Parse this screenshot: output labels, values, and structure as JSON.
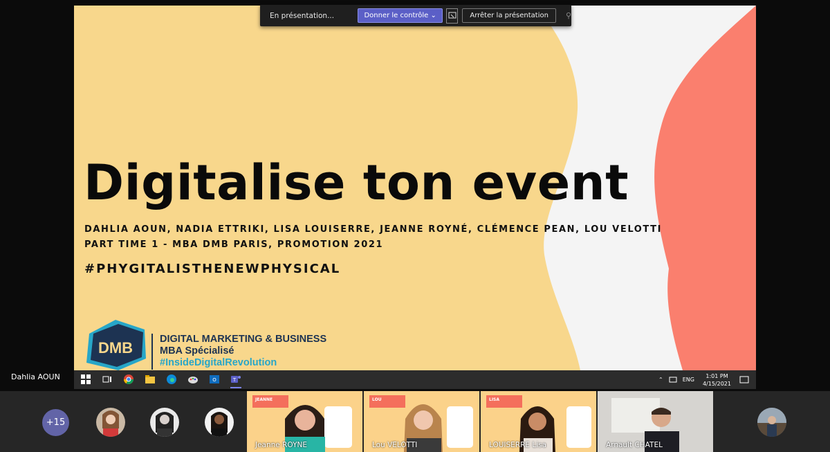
{
  "presentation_bar": {
    "status": "En présentation...",
    "give_control": "Donner le contrôle",
    "stop": "Arrêter la présentation"
  },
  "slide": {
    "title": "Digitalise ton event",
    "authors_line1": "DAHLIA AOUN, NADIA ETTRIKI, LISA LOUISERRE, JEANNE ROYNÉ, CLÉMENCE PEAN, LOU VELOTTI",
    "authors_line2": "PART TIME 1 - MBA DMB PARIS, PROMOTION 2021",
    "hashtag": "#PHYGITALISTHENEWPHYSICAL",
    "logo": {
      "mark": "DMB",
      "line1": "DIGITAL MARKETING & BUSINESS",
      "line2": "MBA Spécialisé",
      "line3": "#InsideDigitalRevolution"
    },
    "colors": {
      "yellow": "#f8d78c",
      "coral": "#fa7f6e",
      "background": "#f4f4f4",
      "logo_navy": "#1d3352",
      "logo_cyan": "#27a6c8"
    }
  },
  "taskbar": {
    "icons": [
      "windows-start-icon",
      "task-view-icon",
      "chrome-icon",
      "file-explorer-icon",
      "edge-icon",
      "paint-icon",
      "outlook-icon",
      "teams-icon"
    ],
    "lang": "ENG",
    "time": "1:01 PM",
    "date": "4/15/2021"
  },
  "presenter": "Dahlia AOUN",
  "participants": {
    "more": "+15",
    "tiles": [
      {
        "name": "Jeanne ROYNE",
        "tag": "JEANNE"
      },
      {
        "name": "Lou VELOTTI",
        "tag": "LOU"
      },
      {
        "name": "LOUISERRE Lisa",
        "tag": "LISA"
      },
      {
        "name": "Arnault CHATEL",
        "tag": ""
      }
    ]
  }
}
